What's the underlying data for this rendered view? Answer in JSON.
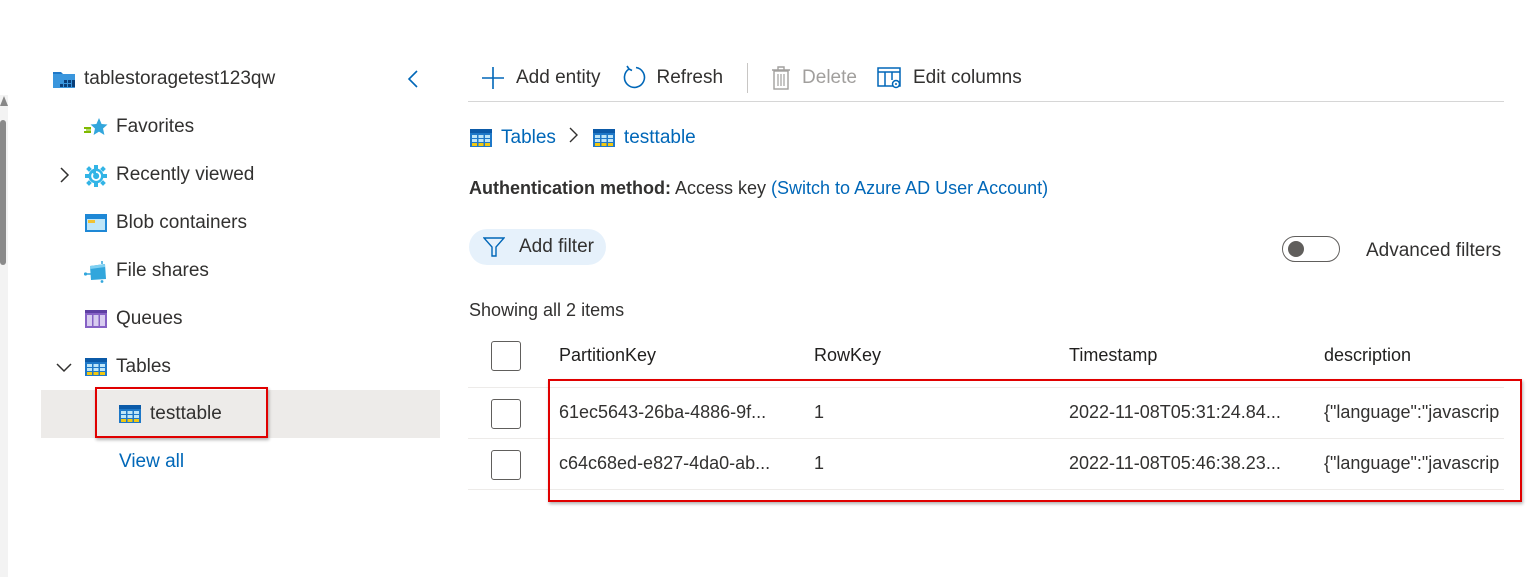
{
  "sidebar": {
    "account_name": "tablestoragetest123qw",
    "items": [
      {
        "label": "Favorites",
        "icon": "favorites-star-icon"
      },
      {
        "label": "Recently viewed",
        "icon": "recently-viewed-icon",
        "expandable": true
      },
      {
        "label": "Blob containers",
        "icon": "blob-containers-icon"
      },
      {
        "label": "File shares",
        "icon": "file-shares-icon"
      },
      {
        "label": "Queues",
        "icon": "queues-icon"
      },
      {
        "label": "Tables",
        "icon": "tables-icon",
        "expanded": true
      },
      {
        "label": "testtable",
        "icon": "table-icon",
        "selected": true
      },
      {
        "label": "View all"
      }
    ]
  },
  "toolbar": {
    "add_entity": "Add entity",
    "refresh": "Refresh",
    "delete": "Delete",
    "edit_columns": "Edit columns"
  },
  "breadcrumb": {
    "root": "Tables",
    "current": "testtable"
  },
  "auth": {
    "label": "Authentication method:",
    "value": "Access key",
    "switch_link": "(Switch to Azure AD User Account)"
  },
  "filters": {
    "add_filter": "Add filter",
    "advanced_filters": "Advanced filters",
    "advanced_enabled": false
  },
  "grid": {
    "summary": "Showing all 2 items",
    "columns": [
      "PartitionKey",
      "RowKey",
      "Timestamp",
      "description"
    ],
    "rows": [
      [
        "61ec5643-26ba-4886-9f...",
        "1",
        "2022-11-08T05:31:24.84...",
        "{\"language\":\"javascrip"
      ],
      [
        "c64c68ed-e827-4da0-ab...",
        "1",
        "2022-11-08T05:46:38.23...",
        "{\"language\":\"javascrip"
      ]
    ]
  },
  "colors": {
    "accent": "#0067b8",
    "highlight_box": "#e00000",
    "selected_bg": "#edebe9",
    "filter_pill_bg": "#e6f1fb"
  }
}
